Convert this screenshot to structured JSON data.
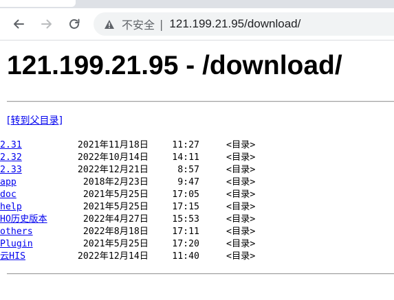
{
  "browser": {
    "insecure_label": "不安全",
    "separator": "|",
    "url": "121.199.21.95/download/"
  },
  "page": {
    "title": "121.199.21.95 - /download/",
    "parent_link": "[转到父目录]"
  },
  "entries": [
    {
      "date": "2021年11月18日",
      "time": "11:27",
      "type": "<目录>",
      "name": "2.31"
    },
    {
      "date": "2022年10月14日",
      "time": "14:11",
      "type": "<目录>",
      "name": "2.32"
    },
    {
      "date": "2022年12月21日",
      "time": "8:57",
      "type": "<目录>",
      "name": "2.33"
    },
    {
      "date": "2018年2月23日",
      "time": "9:47",
      "type": "<目录>",
      "name": "app"
    },
    {
      "date": "2021年5月25日",
      "time": "17:05",
      "type": "<目录>",
      "name": "doc"
    },
    {
      "date": "2021年5月25日",
      "time": "17:15",
      "type": "<目录>",
      "name": "help"
    },
    {
      "date": "2022年4月27日",
      "time": "15:53",
      "type": "<目录>",
      "name": "HO历史版本"
    },
    {
      "date": "2022年8月18日",
      "time": "17:11",
      "type": "<目录>",
      "name": "others"
    },
    {
      "date": "2021年5月25日",
      "time": "17:20",
      "type": "<目录>",
      "name": "Plugin"
    },
    {
      "date": "2022年12月14日",
      "time": "11:40",
      "type": "<目录>",
      "name": "云HIS"
    }
  ]
}
